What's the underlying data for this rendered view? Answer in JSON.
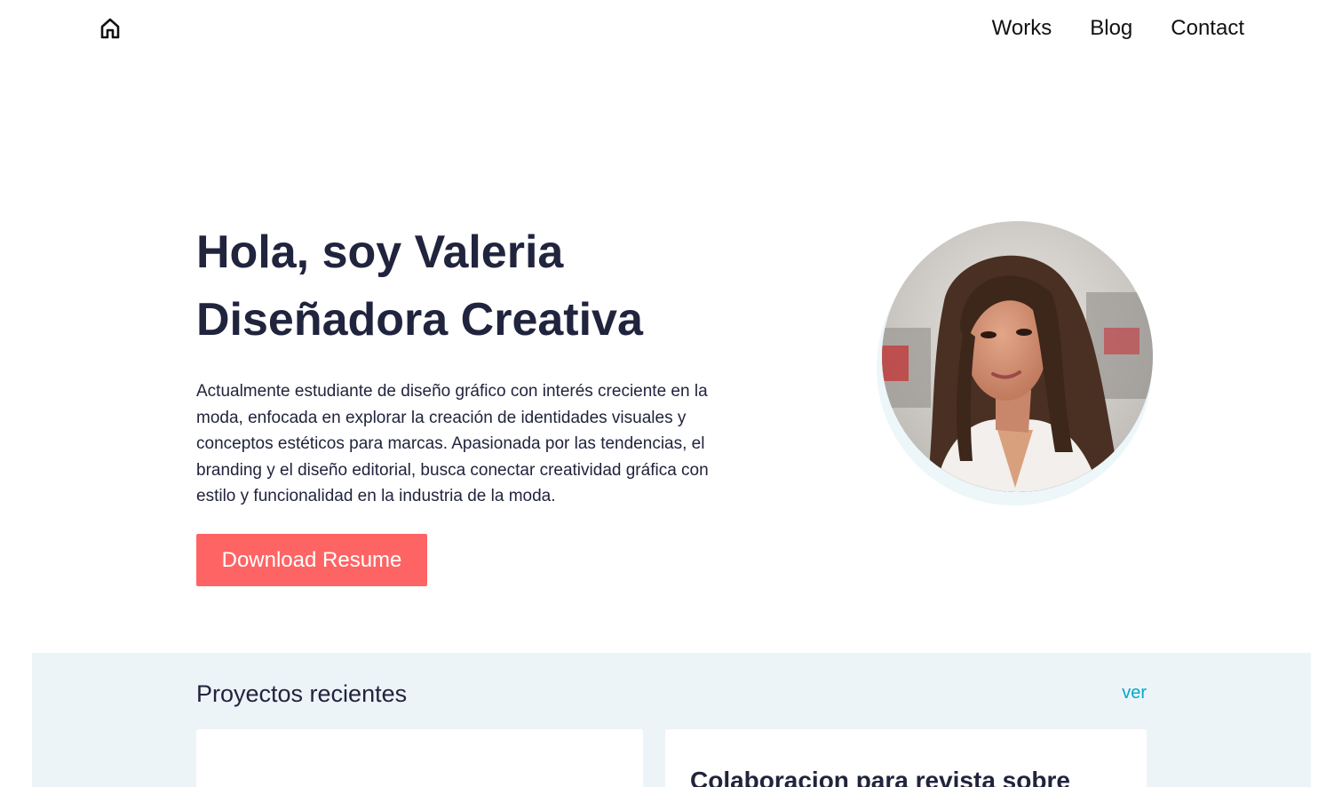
{
  "header": {
    "home_icon": "home-icon",
    "nav": [
      "Works",
      "Blog",
      "Contact"
    ]
  },
  "hero": {
    "title_line1": "Hola, soy Valeria",
    "title_line2": "Diseñadora Creativa",
    "description": "Actualmente estudiante de diseño gráfico con interés creciente en la moda, enfocada en explorar la creación de identidades visuales y conceptos estéticos para marcas. Apasionada por las tendencias, el branding y el diseño editorial, busca conectar creatividad gráfica con estilo y funcionalidad en la industria de la moda.",
    "button_label": "Download Resume",
    "avatar_alt": "profile photo"
  },
  "recent": {
    "title": "Proyectos recientes",
    "link_label": "ver",
    "cards": [
      {
        "title": ""
      },
      {
        "title": "Colaboracion para revista sobre"
      }
    ]
  },
  "colors": {
    "heading": "#21243d",
    "accent_button": "#ff6464",
    "link": "#00a8cc",
    "section_bg": "#edf4f8"
  }
}
